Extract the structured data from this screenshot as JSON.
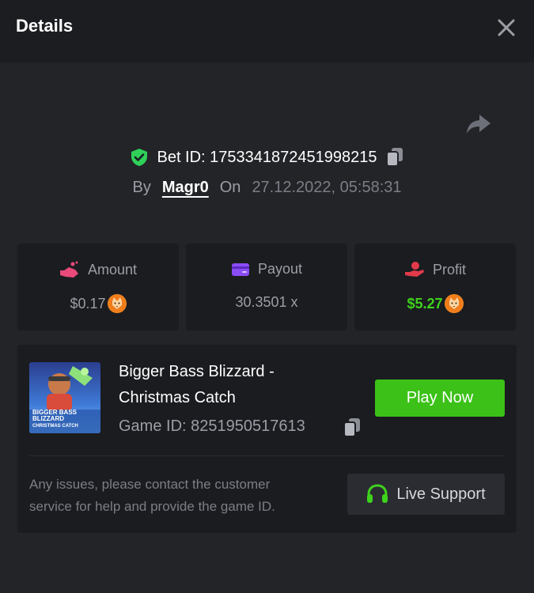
{
  "header": {
    "title": "Details"
  },
  "bet": {
    "id_label": "Bet ID: 1753341872451998215",
    "by_label": "By",
    "user": "Magr0",
    "on_label": "On",
    "datetime": "27.12.2022, 05:58:31"
  },
  "stats": [
    {
      "label": "Amount",
      "value": "$0.17",
      "coin": "shib-coin"
    },
    {
      "label": "Payout",
      "value": "30.3501 x"
    },
    {
      "label": "Profit",
      "value": "$5.27",
      "coin": "shib-coin",
      "value_color": "#3ed21d"
    }
  ],
  "game": {
    "title_line1": "Bigger Bass Blizzard -",
    "title_line2": "Christmas Catch",
    "id_label": "Game ID: 8251950517613",
    "play_label": "Play Now",
    "thumb_text_1": "BIGGER BASS",
    "thumb_text_2": "BLIZZARD",
    "thumb_text_3": "CHRISTMAS CATCH"
  },
  "support": {
    "message_line1": "Any issues, please contact the customer",
    "message_line2": "service for help and provide the game ID.",
    "button_label": "Live Support"
  },
  "colors": {
    "accent_green": "#3bc117",
    "profit_green": "#3ed21d",
    "shield_green": "#2fd15a",
    "payout_purple": "#8b4cf6",
    "amount_pink": "#e94a7a",
    "profit_red": "#e23a4b"
  }
}
